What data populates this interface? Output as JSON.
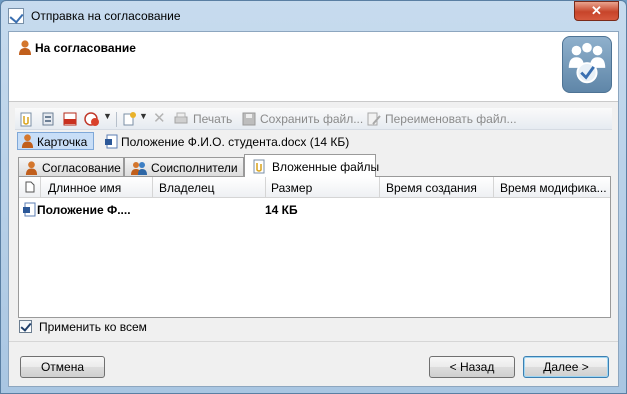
{
  "window": {
    "title": "Отправка на согласование",
    "close_label": "✕"
  },
  "header": {
    "title": "На согласование",
    "icon": "approval-wizard-icon"
  },
  "toolbar": {
    "print_label": "Печать",
    "save_file_label": "Сохранить файл...",
    "rename_file_label": "Переименовать файл..."
  },
  "card": {
    "label": "Карточка",
    "document_label": "Положение Ф.И.О. студента.docx (14 КБ)"
  },
  "tabs": [
    {
      "label": "Согласование",
      "active": false
    },
    {
      "label": "Соисполнители",
      "active": false
    },
    {
      "label": "Вложенные файлы",
      "active": true
    }
  ],
  "files": {
    "columns": [
      "Длинное имя",
      "Владелец",
      "Размер",
      "Время создания",
      "Время модифика..."
    ],
    "rows": [
      {
        "name": "Положение Ф....",
        "owner": "",
        "size": "14 КБ",
        "created": "",
        "modified": ""
      }
    ]
  },
  "apply_all": {
    "label": "Применить ко всем",
    "checked": true
  },
  "footer": {
    "cancel_label": "Отмена",
    "back_label": "< Назад",
    "next_label": "Далее >"
  },
  "colors": {
    "title_bar": "#b9d1ea",
    "close_button": "#c7442a",
    "card_highlight": "#c8def7",
    "person_icon": "#d4762c"
  }
}
